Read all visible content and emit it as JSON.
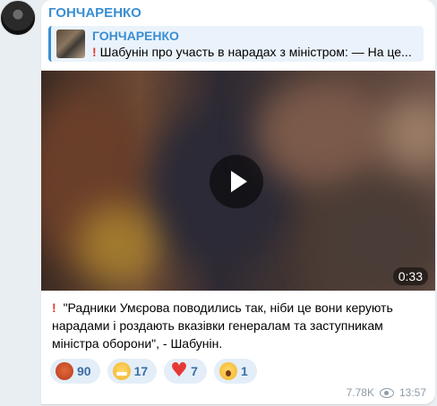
{
  "channel": {
    "name": "ГОНЧАРЕНКО"
  },
  "reply": {
    "title": "ГОНЧАРЕНКО",
    "text": "Шабунін про участь в нарадах з міністром: — На це..."
  },
  "video": {
    "duration": "0:33"
  },
  "message": {
    "text": "\"Радники Умєрова поводились так, ніби це вони керують нарадами і роздають вказівки генералам та заступникам міністра оборони\", - Шабунін."
  },
  "reactions": [
    {
      "emoji": "angry-face-icon",
      "count": "90"
    },
    {
      "emoji": "grinning-face-icon",
      "count": "17"
    },
    {
      "emoji": "red-heart-icon",
      "count": "7"
    },
    {
      "emoji": "yawning-face-icon",
      "count": "1"
    }
  ],
  "meta": {
    "views": "7.78K",
    "time": "13:57"
  },
  "colors": {
    "accent": "#3a8ed1",
    "reaction_bg": "#e4eef8",
    "exclamation": "#e53935"
  }
}
